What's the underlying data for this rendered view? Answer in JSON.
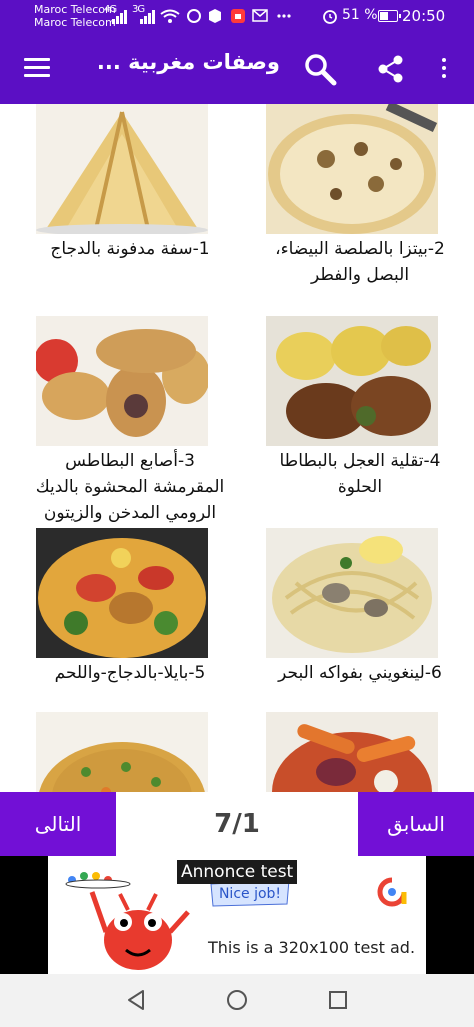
{
  "status_bar": {
    "carrier_1": "Maroc Telecom",
    "carrier_2": "Maroc Telecom",
    "network_1": "4G",
    "network_2": "3G",
    "battery_percent": "51 %",
    "battery_level": 0.51,
    "time": "20:50"
  },
  "app_bar": {
    "title": "وصفات مغربية ..."
  },
  "recipes": [
    {
      "title": "1-سفة مدفونة بالدجاج"
    },
    {
      "title": "2-بيتزا بالصلصة البيضاء، البصل والفطر"
    },
    {
      "title": "3-أصابع البطاطس المقرمشة المحشوة بالديك الرومي المدخن والزيتون"
    },
    {
      "title": "4-تقلية العجل بالبطاطا الحلوة"
    },
    {
      "title": "5-بايلا-بالدجاج-واللحم"
    },
    {
      "title": "6-لينغويني بفواكه البحر"
    },
    {
      "title": ""
    },
    {
      "title": ""
    }
  ],
  "pager": {
    "next_label": "التالى",
    "prev_label": "السابق",
    "count": "7/1"
  },
  "ad": {
    "label": "Annonce test",
    "badge": "Nice job!",
    "text": "This is a 320x100 test ad."
  },
  "colors": {
    "primary": "#5b0fc4",
    "button": "#7210d6"
  }
}
